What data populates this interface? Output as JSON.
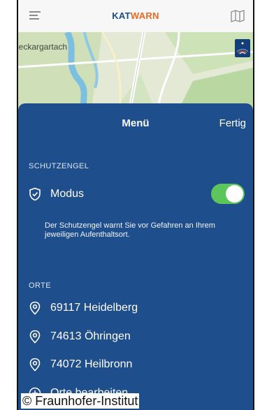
{
  "app": {
    "brand_part1": "KAT",
    "brand_part2": "WARN",
    "colors": {
      "sheet": "#1f4e8c",
      "toggle_on": "#5cc65a",
      "brand_blue": "#1b4b8d",
      "brand_orange": "#e86a24"
    }
  },
  "map": {
    "place_label": "leckargartach"
  },
  "menu": {
    "title": "Menü",
    "done_label": "Fertig",
    "guardian": {
      "header": "SCHUTZENGEL",
      "mode_label": "Modus",
      "mode_on": true,
      "description": "Der Schutzengel warnt Sie vor Gefahren an Ihrem jeweiligen Aufenthaltsort."
    },
    "places": {
      "header": "ORTE",
      "items": [
        {
          "label": "69117 Heidelberg",
          "icon": "location-pin-icon"
        },
        {
          "label": "74613 Öhringen",
          "icon": "location-pin-icon"
        },
        {
          "label": "74072 Heilbronn",
          "icon": "location-pin-icon"
        }
      ],
      "edit_label": "Orte bearbeiten"
    }
  },
  "watermark": "© Fraunhofer-Institut"
}
